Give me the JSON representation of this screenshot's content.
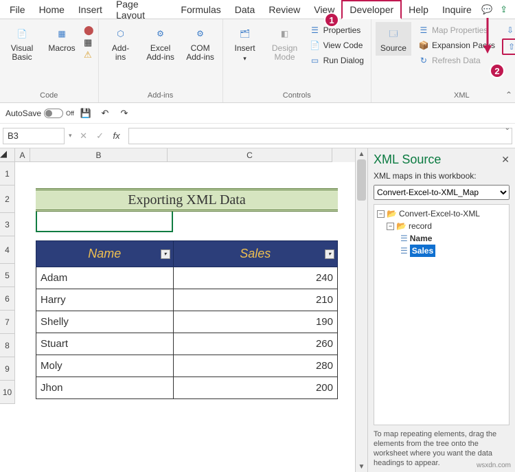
{
  "tabs": [
    "File",
    "Home",
    "Insert",
    "Page Layout",
    "Formulas",
    "Data",
    "Review",
    "View",
    "Developer",
    "Help",
    "Inquire"
  ],
  "activeTab": "Developer",
  "ribbon": {
    "code": {
      "label": "Code",
      "visualBasic": "Visual\nBasic",
      "macros": "Macros"
    },
    "addins": {
      "label": "Add-ins",
      "addins": "Add-\nins",
      "excel": "Excel\nAdd-ins",
      "com": "COM\nAdd-ins"
    },
    "controls": {
      "label": "Controls",
      "insert": "Insert",
      "design": "Design\nMode",
      "properties": "Properties",
      "viewCode": "View Code",
      "runDialog": "Run Dialog"
    },
    "xml": {
      "label": "XML",
      "source": "Source",
      "mapProps": "Map Properties",
      "expansion": "Expansion Packs",
      "refresh": "Refresh Data",
      "import": "Import",
      "export": "Export"
    }
  },
  "qat": {
    "autosaveLabel": "AutoSave",
    "autosaveState": "Off"
  },
  "nameBox": "B3",
  "sheet": {
    "title": "Exporting XML Data",
    "headers": {
      "name": "Name",
      "sales": "Sales"
    },
    "rows": [
      {
        "name": "Adam",
        "sales": 240
      },
      {
        "name": "Harry",
        "sales": 210
      },
      {
        "name": "Shelly",
        "sales": 190
      },
      {
        "name": "Stuart",
        "sales": 260
      },
      {
        "name": "Moly",
        "sales": 280
      },
      {
        "name": "Jhon",
        "sales": 200
      }
    ],
    "cols": [
      "A",
      "B",
      "C"
    ],
    "rowNums": [
      1,
      2,
      3,
      4,
      5,
      6,
      7,
      8,
      9,
      10
    ]
  },
  "xmlPane": {
    "title": "XML Source",
    "sub": "XML maps in this workbook:",
    "mapName": "Convert-Excel-to-XML_Map",
    "root": "Convert-Excel-to-XML",
    "record": "record",
    "fields": [
      "Name",
      "Sales"
    ],
    "hint": "To map repeating elements, drag the elements from the tree onto the worksheet where you want the data headings to appear."
  },
  "callouts": {
    "one": "1",
    "two": "2"
  },
  "watermark": "wsxdn.com"
}
